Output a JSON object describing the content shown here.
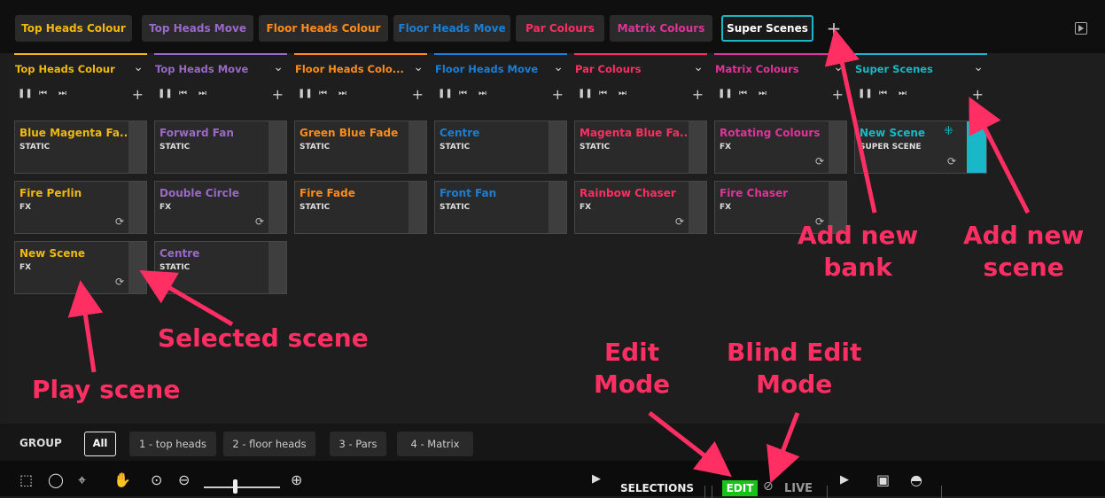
{
  "top_tabs": [
    {
      "label": "Top Heads Colour",
      "color": "#f2b90d"
    },
    {
      "label": "Top Heads Move",
      "color": "#9a69c8"
    },
    {
      "label": "Floor Heads Colour",
      "color": "#ff8c1a"
    },
    {
      "label": "Floor Heads Move",
      "color": "#1a7fd4"
    },
    {
      "label": "Par Colours",
      "color": "#ff2e63"
    },
    {
      "label": "Matrix Colours",
      "color": "#e03399"
    },
    {
      "label": "Super Scenes",
      "color": "#18b8c8",
      "active": true
    }
  ],
  "add_bank_label": "+",
  "banks": [
    {
      "title": "Top Heads Colour",
      "color": "#f2b90d",
      "scenes": [
        {
          "name": "Blue Magenta Fa...",
          "type": "STATIC",
          "loop": false
        },
        {
          "name": "Fire Perlin",
          "type": "FX",
          "loop": true
        },
        {
          "name": "New Scene",
          "type": "FX",
          "loop": true
        }
      ]
    },
    {
      "title": "Top Heads Move",
      "color": "#9a69c8",
      "scenes": [
        {
          "name": "Forward Fan",
          "type": "STATIC",
          "loop": false
        },
        {
          "name": "Double Circle",
          "type": "FX",
          "loop": true
        },
        {
          "name": "Centre",
          "type": "STATIC",
          "loop": false
        }
      ]
    },
    {
      "title": "Floor Heads Colo...",
      "color": "#ff8c1a",
      "scenes": [
        {
          "name": "Green Blue Fade",
          "type": "STATIC",
          "loop": false
        },
        {
          "name": "Fire Fade",
          "type": "STATIC",
          "loop": false
        }
      ]
    },
    {
      "title": "Floor Heads Move",
      "color": "#1a7fd4",
      "scenes": [
        {
          "name": "Centre",
          "type": "STATIC",
          "loop": false
        },
        {
          "name": "Front Fan",
          "type": "STATIC",
          "loop": false
        }
      ]
    },
    {
      "title": "Par Colours",
      "color": "#ff2e63",
      "scenes": [
        {
          "name": "Magenta Blue Fa...",
          "type": "STATIC",
          "loop": false
        },
        {
          "name": "Rainbow Chaser",
          "type": "FX",
          "loop": true
        }
      ]
    },
    {
      "title": "Matrix Colours",
      "color": "#e03399",
      "scenes": [
        {
          "name": "Rotating Colours",
          "type": "FX",
          "loop": true
        },
        {
          "name": "Fire Chaser",
          "type": "FX",
          "loop": true
        }
      ]
    },
    {
      "title": "Super Scenes",
      "color": "#18b8c8",
      "super": true,
      "scenes": [
        {
          "name": "New Scene",
          "type": "SUPER SCENE",
          "loop": true
        }
      ]
    }
  ],
  "group": {
    "label": "GROUP",
    "buttons": [
      "All",
      "1 - top heads",
      "2 - floor heads",
      "3 - Pars",
      "4 - Matrix"
    ],
    "active": "All"
  },
  "toolbar": {
    "selections_label": "SELECTIONS",
    "edit_label": "EDIT",
    "live_label": "LIVE"
  },
  "annotations": {
    "add_new_bank": "Add new\nbank",
    "add_new_scene": "Add new\nscene",
    "selected_scene": "Selected scene",
    "play_scene": "Play scene",
    "edit_mode": "Edit\nMode",
    "blind_edit_mode": "Blind Edit\nMode"
  }
}
